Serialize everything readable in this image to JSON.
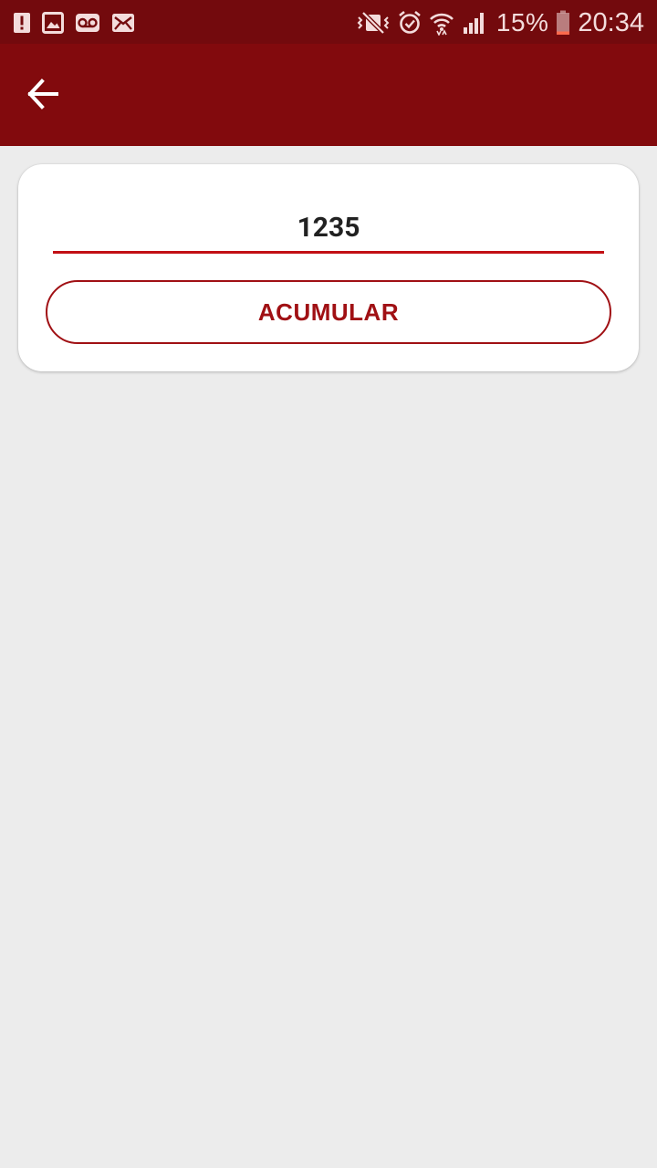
{
  "status_bar": {
    "left_icons": [
      "alert-icon",
      "image-icon",
      "voicemail-icon",
      "email-icon"
    ],
    "right_icons": [
      "vibrate-mute-icon",
      "alarm-icon",
      "wifi-icon",
      "signal-icon",
      "battery-icon"
    ],
    "battery_percent": "15%",
    "time": "20:34",
    "background_color": "#730a0d"
  },
  "app_bar": {
    "back_icon": "arrow-back-icon",
    "background_color": "#820a0d"
  },
  "form": {
    "code_value": "1235",
    "accent_color": "#c20f14"
  },
  "actions": {
    "acumular_label": "ACUMULAR"
  },
  "page": {
    "background_color": "#ececec"
  }
}
